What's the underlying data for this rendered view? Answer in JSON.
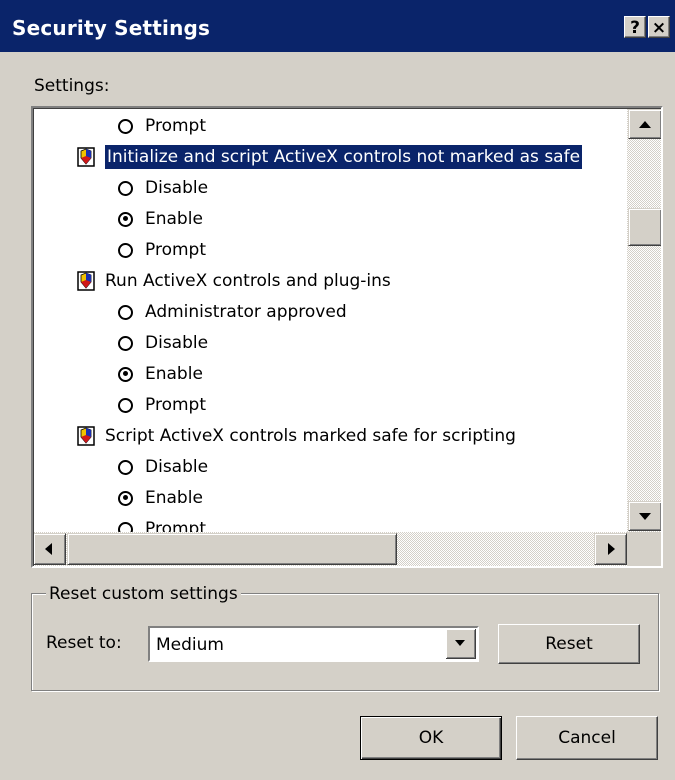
{
  "window": {
    "title": "Security Settings",
    "help_button": "?",
    "close_button": "×"
  },
  "settings_label": "Settings:",
  "list": {
    "rows": [
      {
        "type": "option",
        "label": "Prompt",
        "checked": false
      },
      {
        "type": "setting",
        "label": "Initialize and script ActiveX controls not marked as safe",
        "selected": true
      },
      {
        "type": "option",
        "label": "Disable",
        "checked": false
      },
      {
        "type": "option",
        "label": "Enable",
        "checked": true
      },
      {
        "type": "option",
        "label": "Prompt",
        "checked": false
      },
      {
        "type": "setting",
        "label": "Run ActiveX controls and plug-ins",
        "selected": false
      },
      {
        "type": "option",
        "label": "Administrator approved",
        "checked": false
      },
      {
        "type": "option",
        "label": "Disable",
        "checked": false
      },
      {
        "type": "option",
        "label": "Enable",
        "checked": true
      },
      {
        "type": "option",
        "label": "Prompt",
        "checked": false
      },
      {
        "type": "setting",
        "label": "Script ActiveX controls marked safe for scripting",
        "selected": false
      },
      {
        "type": "option",
        "label": "Disable",
        "checked": false
      },
      {
        "type": "option",
        "label": "Enable",
        "checked": true
      },
      {
        "type": "option",
        "label": "Prompt",
        "checked": false
      }
    ]
  },
  "reset_group": {
    "legend": "Reset custom settings",
    "reset_to_label": "Reset to:",
    "selected_level": "Medium",
    "reset_button": "Reset"
  },
  "buttons": {
    "ok": "OK",
    "cancel": "Cancel"
  },
  "colors": {
    "title_bar": "#0a246a",
    "selection": "#0a246a",
    "face": "#d4d0c8"
  }
}
